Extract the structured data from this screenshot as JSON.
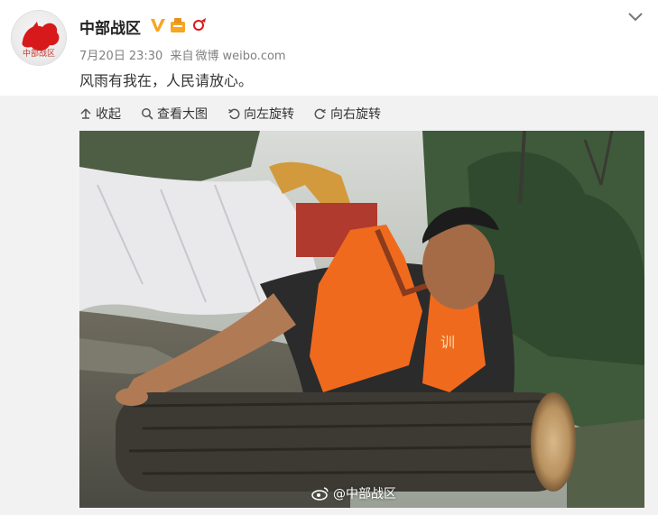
{
  "post": {
    "username": "中部战区",
    "avatar_text": "中部战区",
    "date": "7月20日",
    "time": "23:30",
    "source_prefix": "来自",
    "source": "微博",
    "source_site": "weibo.com",
    "text": "风雨有我在，人民请放心。"
  },
  "toolbar": {
    "collapse_label": "收起",
    "view_large_label": "查看大图",
    "rotate_left_label": "向左旋转",
    "rotate_right_label": "向右旋转"
  },
  "image": {
    "watermark": "@中部战区",
    "vest_text": "训"
  },
  "icons": {
    "verified": "verified-v-icon",
    "chevron": "chevron-down-icon",
    "collapse": "collapse-up-arrow-icon",
    "zoom": "magnifier-icon",
    "rotate_left": "rotate-left-icon",
    "rotate_right": "rotate-right-icon",
    "weibo": "weibo-logo-icon"
  },
  "colors": {
    "verified": "#f5a623",
    "vest": "#f06a1e",
    "accent_red": "#d7191c"
  }
}
